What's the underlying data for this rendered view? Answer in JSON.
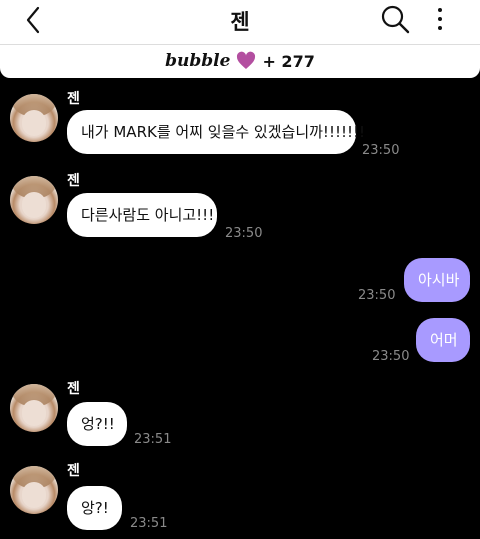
{
  "header": {
    "title": "젠"
  },
  "banner": {
    "brand": "bubble",
    "count": "+ 277"
  },
  "messages": [
    {
      "sender": "젠",
      "text": "내가 MARK를 어찌 잊을수 있겠습니까!!!!!!!",
      "time": "23:50"
    },
    {
      "sender": "젠",
      "text": "다른사람도 아니고!!!",
      "time": "23:50"
    },
    {
      "text": "아시바",
      "time": "23:50"
    },
    {
      "text": "어머",
      "time": "23:50"
    },
    {
      "sender": "젠",
      "text": "엉?!!",
      "time": "23:51"
    },
    {
      "sender": "젠",
      "text": "앙?!",
      "time": "23:51"
    }
  ],
  "colors": {
    "my_bubble": "#a89aff",
    "their_bubble": "#ffffff",
    "background": "#000000",
    "heart": "#b34fa0"
  },
  "icons": [
    "back-icon",
    "search-icon",
    "more-icon",
    "heart-icon"
  ]
}
